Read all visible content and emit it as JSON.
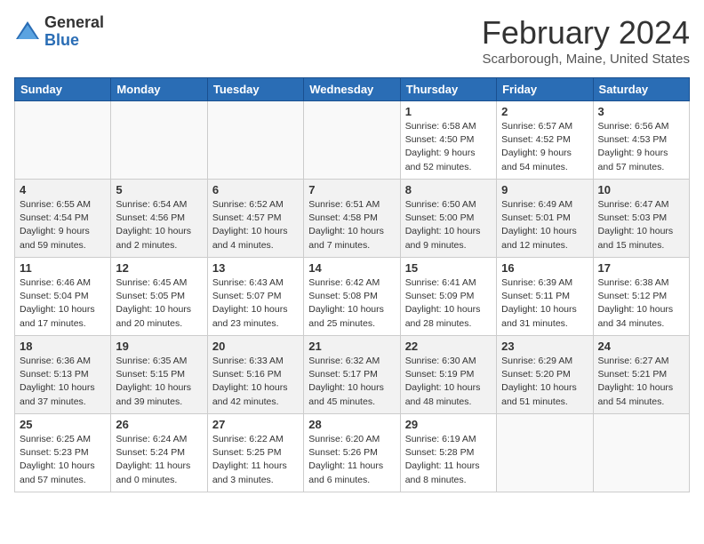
{
  "header": {
    "logo_general": "General",
    "logo_blue": "Blue",
    "month_title": "February 2024",
    "location": "Scarborough, Maine, United States"
  },
  "days_of_week": [
    "Sunday",
    "Monday",
    "Tuesday",
    "Wednesday",
    "Thursday",
    "Friday",
    "Saturday"
  ],
  "weeks": [
    [
      {
        "day": "",
        "sunrise": "",
        "sunset": "",
        "daylight": "",
        "empty": true
      },
      {
        "day": "",
        "sunrise": "",
        "sunset": "",
        "daylight": "",
        "empty": true
      },
      {
        "day": "",
        "sunrise": "",
        "sunset": "",
        "daylight": "",
        "empty": true
      },
      {
        "day": "",
        "sunrise": "",
        "sunset": "",
        "daylight": "",
        "empty": true
      },
      {
        "day": "1",
        "sunrise": "Sunrise: 6:58 AM",
        "sunset": "Sunset: 4:50 PM",
        "daylight": "Daylight: 9 hours and 52 minutes.",
        "empty": false
      },
      {
        "day": "2",
        "sunrise": "Sunrise: 6:57 AM",
        "sunset": "Sunset: 4:52 PM",
        "daylight": "Daylight: 9 hours and 54 minutes.",
        "empty": false
      },
      {
        "day": "3",
        "sunrise": "Sunrise: 6:56 AM",
        "sunset": "Sunset: 4:53 PM",
        "daylight": "Daylight: 9 hours and 57 minutes.",
        "empty": false
      }
    ],
    [
      {
        "day": "4",
        "sunrise": "Sunrise: 6:55 AM",
        "sunset": "Sunset: 4:54 PM",
        "daylight": "Daylight: 9 hours and 59 minutes.",
        "empty": false
      },
      {
        "day": "5",
        "sunrise": "Sunrise: 6:54 AM",
        "sunset": "Sunset: 4:56 PM",
        "daylight": "Daylight: 10 hours and 2 minutes.",
        "empty": false
      },
      {
        "day": "6",
        "sunrise": "Sunrise: 6:52 AM",
        "sunset": "Sunset: 4:57 PM",
        "daylight": "Daylight: 10 hours and 4 minutes.",
        "empty": false
      },
      {
        "day": "7",
        "sunrise": "Sunrise: 6:51 AM",
        "sunset": "Sunset: 4:58 PM",
        "daylight": "Daylight: 10 hours and 7 minutes.",
        "empty": false
      },
      {
        "day": "8",
        "sunrise": "Sunrise: 6:50 AM",
        "sunset": "Sunset: 5:00 PM",
        "daylight": "Daylight: 10 hours and 9 minutes.",
        "empty": false
      },
      {
        "day": "9",
        "sunrise": "Sunrise: 6:49 AM",
        "sunset": "Sunset: 5:01 PM",
        "daylight": "Daylight: 10 hours and 12 minutes.",
        "empty": false
      },
      {
        "day": "10",
        "sunrise": "Sunrise: 6:47 AM",
        "sunset": "Sunset: 5:03 PM",
        "daylight": "Daylight: 10 hours and 15 minutes.",
        "empty": false
      }
    ],
    [
      {
        "day": "11",
        "sunrise": "Sunrise: 6:46 AM",
        "sunset": "Sunset: 5:04 PM",
        "daylight": "Daylight: 10 hours and 17 minutes.",
        "empty": false
      },
      {
        "day": "12",
        "sunrise": "Sunrise: 6:45 AM",
        "sunset": "Sunset: 5:05 PM",
        "daylight": "Daylight: 10 hours and 20 minutes.",
        "empty": false
      },
      {
        "day": "13",
        "sunrise": "Sunrise: 6:43 AM",
        "sunset": "Sunset: 5:07 PM",
        "daylight": "Daylight: 10 hours and 23 minutes.",
        "empty": false
      },
      {
        "day": "14",
        "sunrise": "Sunrise: 6:42 AM",
        "sunset": "Sunset: 5:08 PM",
        "daylight": "Daylight: 10 hours and 25 minutes.",
        "empty": false
      },
      {
        "day": "15",
        "sunrise": "Sunrise: 6:41 AM",
        "sunset": "Sunset: 5:09 PM",
        "daylight": "Daylight: 10 hours and 28 minutes.",
        "empty": false
      },
      {
        "day": "16",
        "sunrise": "Sunrise: 6:39 AM",
        "sunset": "Sunset: 5:11 PM",
        "daylight": "Daylight: 10 hours and 31 minutes.",
        "empty": false
      },
      {
        "day": "17",
        "sunrise": "Sunrise: 6:38 AM",
        "sunset": "Sunset: 5:12 PM",
        "daylight": "Daylight: 10 hours and 34 minutes.",
        "empty": false
      }
    ],
    [
      {
        "day": "18",
        "sunrise": "Sunrise: 6:36 AM",
        "sunset": "Sunset: 5:13 PM",
        "daylight": "Daylight: 10 hours and 37 minutes.",
        "empty": false
      },
      {
        "day": "19",
        "sunrise": "Sunrise: 6:35 AM",
        "sunset": "Sunset: 5:15 PM",
        "daylight": "Daylight: 10 hours and 39 minutes.",
        "empty": false
      },
      {
        "day": "20",
        "sunrise": "Sunrise: 6:33 AM",
        "sunset": "Sunset: 5:16 PM",
        "daylight": "Daylight: 10 hours and 42 minutes.",
        "empty": false
      },
      {
        "day": "21",
        "sunrise": "Sunrise: 6:32 AM",
        "sunset": "Sunset: 5:17 PM",
        "daylight": "Daylight: 10 hours and 45 minutes.",
        "empty": false
      },
      {
        "day": "22",
        "sunrise": "Sunrise: 6:30 AM",
        "sunset": "Sunset: 5:19 PM",
        "daylight": "Daylight: 10 hours and 48 minutes.",
        "empty": false
      },
      {
        "day": "23",
        "sunrise": "Sunrise: 6:29 AM",
        "sunset": "Sunset: 5:20 PM",
        "daylight": "Daylight: 10 hours and 51 minutes.",
        "empty": false
      },
      {
        "day": "24",
        "sunrise": "Sunrise: 6:27 AM",
        "sunset": "Sunset: 5:21 PM",
        "daylight": "Daylight: 10 hours and 54 minutes.",
        "empty": false
      }
    ],
    [
      {
        "day": "25",
        "sunrise": "Sunrise: 6:25 AM",
        "sunset": "Sunset: 5:23 PM",
        "daylight": "Daylight: 10 hours and 57 minutes.",
        "empty": false
      },
      {
        "day": "26",
        "sunrise": "Sunrise: 6:24 AM",
        "sunset": "Sunset: 5:24 PM",
        "daylight": "Daylight: 11 hours and 0 minutes.",
        "empty": false
      },
      {
        "day": "27",
        "sunrise": "Sunrise: 6:22 AM",
        "sunset": "Sunset: 5:25 PM",
        "daylight": "Daylight: 11 hours and 3 minutes.",
        "empty": false
      },
      {
        "day": "28",
        "sunrise": "Sunrise: 6:20 AM",
        "sunset": "Sunset: 5:26 PM",
        "daylight": "Daylight: 11 hours and 6 minutes.",
        "empty": false
      },
      {
        "day": "29",
        "sunrise": "Sunrise: 6:19 AM",
        "sunset": "Sunset: 5:28 PM",
        "daylight": "Daylight: 11 hours and 8 minutes.",
        "empty": false
      },
      {
        "day": "",
        "sunrise": "",
        "sunset": "",
        "daylight": "",
        "empty": true
      },
      {
        "day": "",
        "sunrise": "",
        "sunset": "",
        "daylight": "",
        "empty": true
      }
    ]
  ]
}
